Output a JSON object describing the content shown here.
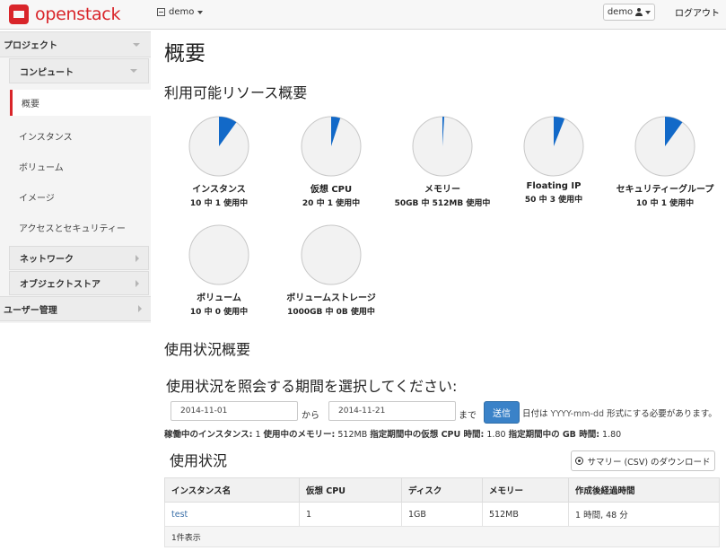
{
  "app": {
    "logo_text": "openstack"
  },
  "topbar": {
    "project_name": "demo",
    "user_name": "demo",
    "logout_label": "ログアウト"
  },
  "sidebar": {
    "project_label": "プロジェクト",
    "compute_label": "コンピュート",
    "items": [
      {
        "label": "概要",
        "active": true
      },
      {
        "label": "インスタンス"
      },
      {
        "label": "ボリューム"
      },
      {
        "label": "イメージ"
      },
      {
        "label": "アクセスとセキュリティー"
      }
    ],
    "network_label": "ネットワーク",
    "object_store_label": "オブジェクトストア",
    "user_admin_label": "ユーザー管理"
  },
  "main": {
    "page_title": "概要",
    "limits_heading": "利用可能リソース概要",
    "usage_summary_heading": "使用状況概要",
    "period_prompt": "使用状況を照会する期間を選択してください:",
    "usage_heading": "使用状況"
  },
  "limits": [
    {
      "title": "インスタンス",
      "subtitle": "10 中 1 使用中",
      "used": 1,
      "total": 10
    },
    {
      "title": "仮想 CPU",
      "subtitle": "20 中 1 使用中",
      "used": 1,
      "total": 20
    },
    {
      "title": "メモリー",
      "subtitle": "50GB 中 512MB 使用中",
      "used": 0.5,
      "total": 50
    },
    {
      "title": "Floating IP",
      "subtitle": "50 中 3 使用中",
      "used": 3,
      "total": 50
    },
    {
      "title": "セキュリティーグループ",
      "subtitle": "10 中 1 使用中",
      "used": 1,
      "total": 10
    },
    {
      "title": "ボリューム",
      "subtitle": "10 中 0 使用中",
      "used": 0,
      "total": 10
    },
    {
      "title": "ボリュームストレージ",
      "subtitle": "1000GB 中 0B 使用中",
      "used": 0,
      "total": 1000
    }
  ],
  "date_form": {
    "start_value": "2014-11-01",
    "from_label": "から",
    "end_value": "2014-11-21",
    "until_label": "まで",
    "submit_label": "送信",
    "hint_prefix": "日付は",
    "hint_format": "YYYY-mm-dd",
    "hint_suffix": "形式にする必要があります。"
  },
  "summary": {
    "active_instances_label": "稼働中のインスタンス:",
    "active_instances_value": "1",
    "active_memory_label": "使用中のメモリー:",
    "active_memory_value": "512MB",
    "cpu_hours_label": "指定期間中の仮想 CPU 時間:",
    "cpu_hours_value": "1.80",
    "gb_hours_label": "指定期間中の GB 時間:",
    "gb_hours_value": "1.80"
  },
  "csv_button_label": "サマリー (CSV) のダウンロード",
  "usage_table": {
    "columns": [
      "インスタンス名",
      "仮想 CPU",
      "ディスク",
      "メモリー",
      "作成後経過時間"
    ],
    "rows": [
      [
        "test",
        "1",
        "1GB",
        "512MB",
        "1 時間, 48 分"
      ]
    ],
    "footer": "1件表示"
  },
  "colors": {
    "accent": "#d9252a",
    "pie_fill": "#1269c8",
    "pie_bg": "#f2f2f2",
    "button": "#3a82c8"
  }
}
